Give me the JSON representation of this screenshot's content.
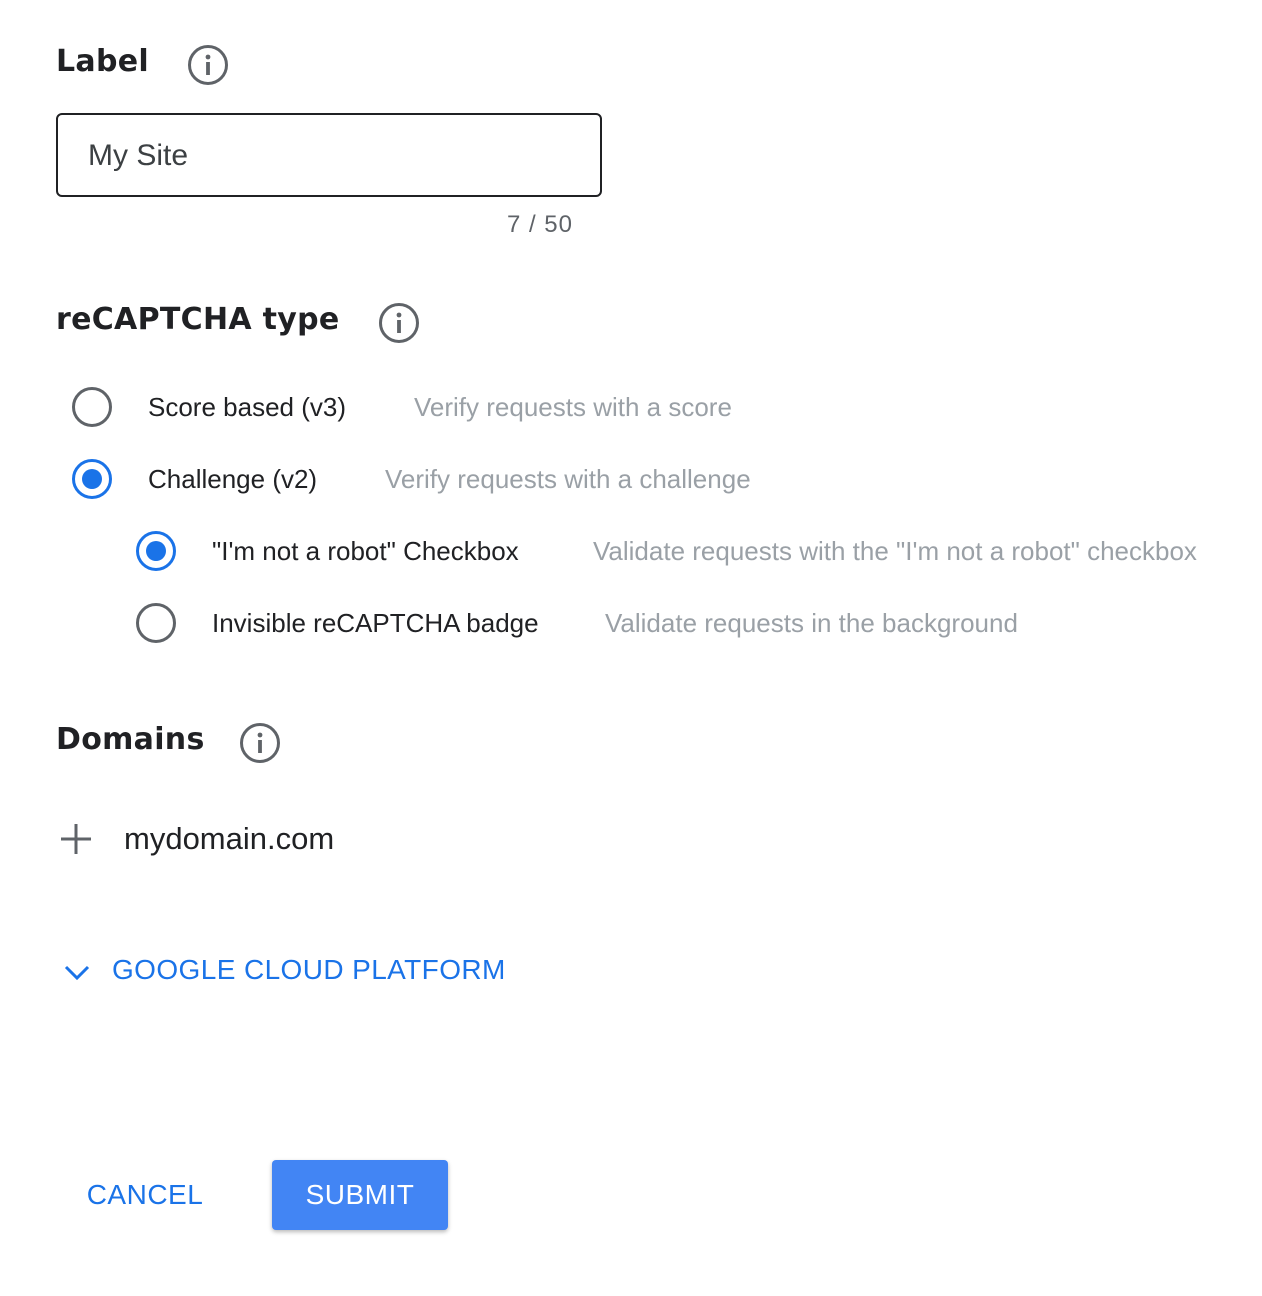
{
  "label_section": {
    "heading": "Label",
    "info_icon": "info-circle-icon",
    "input_value": "My Site",
    "counter": "7 / 50"
  },
  "type_section": {
    "heading": "reCAPTCHA type",
    "info_icon": "info-circle-icon",
    "options": [
      {
        "label": "Score based (v3)",
        "description": "Verify requests with a score",
        "selected": false
      },
      {
        "label": "Challenge (v2)",
        "description": "Verify requests with a challenge",
        "selected": true
      }
    ],
    "suboptions": [
      {
        "label": "\"I'm not a robot\" Checkbox",
        "description": "Validate requests with the \"I'm not a robot\" checkbox",
        "selected": true
      },
      {
        "label": "Invisible reCAPTCHA badge",
        "description": "Validate requests in the background",
        "selected": false
      }
    ]
  },
  "domains_section": {
    "heading": "Domains",
    "info_icon": "info-circle-icon",
    "add_icon": "plus-icon",
    "domain_value": "mydomain.com"
  },
  "gcp_section": {
    "icon": "chevron-down-icon",
    "label": "GOOGLE CLOUD PLATFORM"
  },
  "actions": {
    "cancel_label": "CANCEL",
    "submit_label": "SUBMIT"
  },
  "colors": {
    "accent": "#1a73e8",
    "submit_background": "#4285f4",
    "text": "#202124",
    "secondary_text": "#9aa0a6",
    "icon_gray": "#5f6368"
  }
}
